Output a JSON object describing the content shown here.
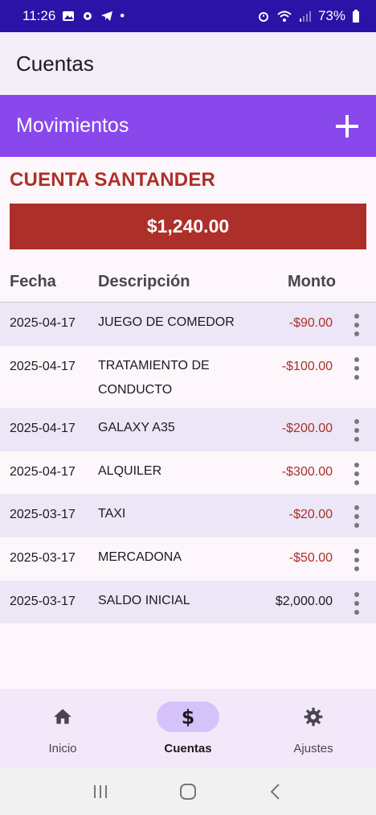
{
  "status_bar": {
    "time": "11:26",
    "dot": "•",
    "battery": "73%"
  },
  "app_bar": {
    "title": "Cuentas"
  },
  "section": {
    "title": "Movimientos",
    "add_icon": "plus-icon"
  },
  "account": {
    "name": "CUENTA SANTANDER",
    "balance": "$1,240.00"
  },
  "table": {
    "headers": {
      "date": "Fecha",
      "description": "Descripción",
      "amount": "Monto"
    },
    "rows": [
      {
        "date": "2025-04-17",
        "description": "JUEGO DE COMEDOR",
        "amount": "-$90.00"
      },
      {
        "date": "2025-04-17",
        "description": "TRATAMIENTO DE CONDUCTO",
        "amount": "-$100.00"
      },
      {
        "date": "2025-04-17",
        "description": "GALAXY A35",
        "amount": "-$200.00"
      },
      {
        "date": "2025-04-17",
        "description": "ALQUILER",
        "amount": "-$300.00"
      },
      {
        "date": "2025-03-17",
        "description": "TAXI",
        "amount": "-$20.00"
      },
      {
        "date": "2025-03-17",
        "description": "MERCADONA",
        "amount": "-$50.00"
      },
      {
        "date": "2025-03-17",
        "description": "SALDO INICIAL",
        "amount": "$2,000.00"
      }
    ]
  },
  "bottom_nav": {
    "items": [
      {
        "label": "Inicio",
        "icon": "home-icon"
      },
      {
        "label": "Cuentas",
        "icon": "dollar-icon"
      },
      {
        "label": "Ajustes",
        "icon": "gear-icon"
      }
    ],
    "active": "Cuentas"
  },
  "colors": {
    "status_bar": "#2a13a6",
    "header": "#8948ec",
    "accent_red": "#ad2f2a",
    "nav_pill": "#d5c2fb"
  }
}
